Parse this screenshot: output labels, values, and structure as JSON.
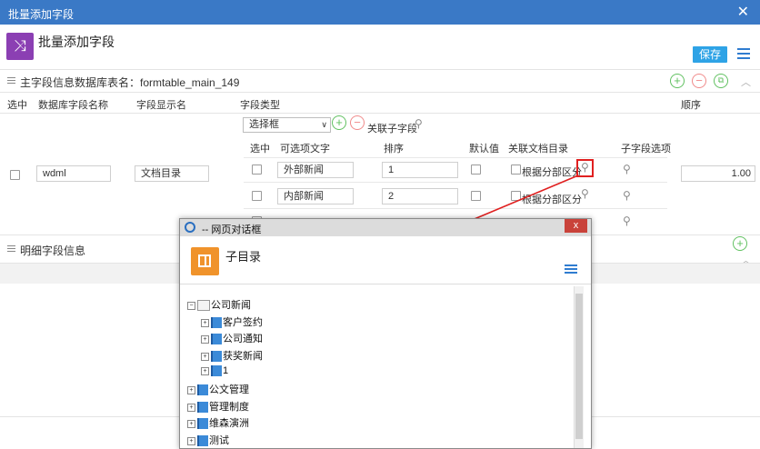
{
  "window": {
    "title": "批量添加字段",
    "close": "✕"
  },
  "header": {
    "title": "批量添加字段",
    "save_label": "保存"
  },
  "main_section": {
    "title": "主字段信息数据库表名：formtable_main_149"
  },
  "columns": {
    "select": "选中",
    "db_name": "数据库字段名称",
    "display": "字段显示名",
    "type": "字段类型",
    "order": "顺序"
  },
  "field": {
    "db_name": "wdml",
    "display_name": "文档目录",
    "type_select": "选择框",
    "order": "1.00"
  },
  "type_panel": {
    "link_label": "关联子字段",
    "headers": {
      "select": "选中",
      "option_text": "可选项文字",
      "order": "排序",
      "default": "默认值",
      "doc_dir": "关联文档目录",
      "sub_option": "子字段选项"
    },
    "rows": [
      {
        "text": "外部新闻",
        "order": "1",
        "doc_label": "根据分部区分"
      },
      {
        "text": "内部新闻",
        "order": "2",
        "doc_label": "根据分部区分"
      }
    ]
  },
  "detail_section": {
    "title": "明细字段信息"
  },
  "dialog": {
    "title": "-- 网页对话框",
    "header": "子目录",
    "close": "x",
    "tree": [
      {
        "label": "公司新闻",
        "level": 0,
        "expanded": true
      },
      {
        "label": "客户签约",
        "level": 1
      },
      {
        "label": "公司通知",
        "level": 1
      },
      {
        "label": "获奖新闻",
        "level": 1
      },
      {
        "label": "1",
        "level": 1
      },
      {
        "label": "公文管理",
        "level": 0
      },
      {
        "label": "管理制度",
        "level": 0
      },
      {
        "label": "维森演洲",
        "level": 0
      },
      {
        "label": "测试",
        "level": 0
      }
    ]
  },
  "colors": {
    "titlebar": "#3a79c6",
    "accent_purple": "#8b3fb3",
    "save_button": "#2ea3e6",
    "dialog_icon": "#f0932b",
    "arrow": "#e02020"
  },
  "icons": [
    "shuffle-icon",
    "list-menu-icon",
    "add-icon",
    "remove-icon",
    "copy-icon",
    "chevron-up-icon",
    "search-icon",
    "book-icon",
    "folder-icon"
  ]
}
